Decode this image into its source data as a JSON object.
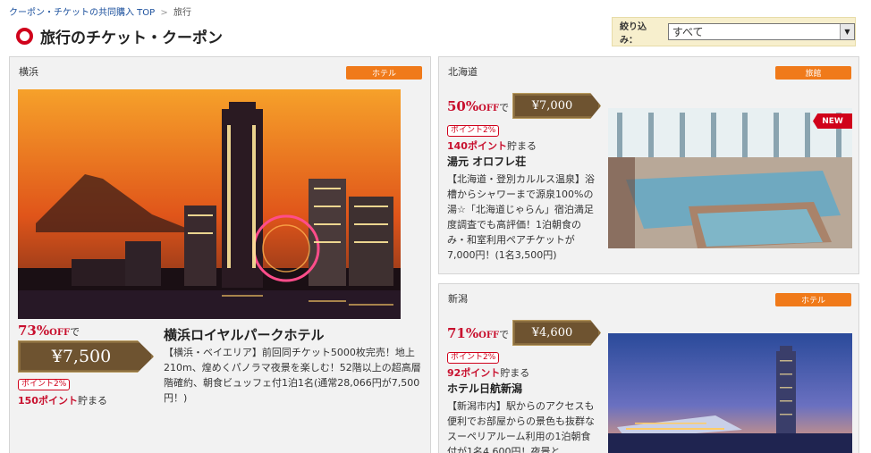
{
  "breadcrumb": {
    "home": "クーポン・チケットの共同購入 TOP",
    "separator": ">",
    "current": "旅行"
  },
  "page_title": "旅行のチケット・クーポン",
  "filter": {
    "label": "絞り込み：",
    "selected": "すべて",
    "arrow": "▼"
  },
  "cards": [
    {
      "region": "横浜",
      "category": "ホテル",
      "discount_pct": "73%",
      "discount_off": "OFF",
      "discount_de": "で",
      "price": "¥7,500",
      "point_badge": "ポイント2%",
      "points": "150ポイント",
      "points_suffix": "貯まる",
      "name": "横浜ロイヤルパークホテル",
      "desc": "【横浜・ベイエリア】前回同チケット5000枚完売！地上210m、煌めくパノラマ夜景を楽しむ！52階以上の超高層階確約、朝食ビュッフェ付1泊1名(通常28,066円が7,500円！)",
      "photo_icon": "yokohama-night-skyline"
    },
    {
      "region": "北海道",
      "category": "旅館",
      "discount_pct": "50%",
      "discount_off": "OFF",
      "discount_de": "で",
      "price": "¥7,000",
      "point_badge": "ポイント2%",
      "points": "140ポイント",
      "points_suffix": "貯まる",
      "name": "湯元 オロフレ荘",
      "desc": "【北海道・登別カルルス温泉】浴槽からシャワーまで源泉100%の湯☆「北海道じゃらん」宿泊満足度調査でも高評価！1泊朝食のみ・和室利用ペアチケットが7,000円！(1名3,500円)",
      "new_label": "NEW",
      "photo_icon": "onsen-bath"
    },
    {
      "region": "新潟",
      "category": "ホテル",
      "discount_pct": "71%",
      "discount_off": "OFF",
      "discount_de": "で",
      "price": "¥4,600",
      "point_badge": "ポイント2%",
      "points": "92ポイント",
      "points_suffix": "貯まる",
      "name": "ホテル日航新潟",
      "desc": "【新潟市内】駅からのアクセスも便利でお部屋からの景色も抜群なスーペリアルーム利用の1泊朝食付が1名4,600円！夜景と",
      "photo_icon": "niigata-tower-sunset"
    }
  ],
  "colors": {
    "accent_red": "#c8102e",
    "badge_orange": "#f07a1a",
    "price_brown": "#6e5330",
    "filter_bg": "#f7efcd"
  }
}
